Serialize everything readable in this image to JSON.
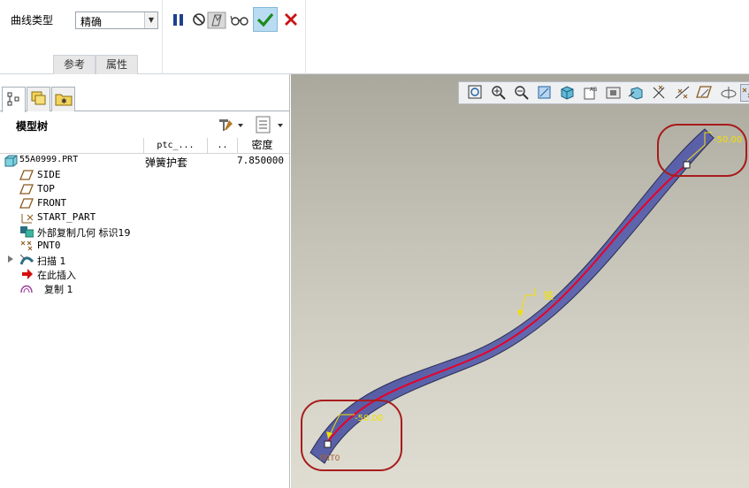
{
  "dashboard": {
    "curve_type_label": "曲线类型",
    "curve_type_value": "精确",
    "tabs": [
      {
        "label": "参考"
      },
      {
        "label": "属性"
      }
    ]
  },
  "tree": {
    "title": "模型树",
    "columns": [
      "ptc_...",
      "..",
      "密度"
    ],
    "rows": [
      {
        "name": "55A0999.PRT",
        "icon": "part-icon",
        "c1": "弹簧护套",
        "c3": "7.850000"
      },
      {
        "name": "SIDE",
        "icon": "datum-plane-icon"
      },
      {
        "name": "TOP",
        "icon": "datum-plane-icon"
      },
      {
        "name": "FRONT",
        "icon": "datum-plane-icon"
      },
      {
        "name": "START_PART",
        "icon": "csys-icon"
      },
      {
        "name": "外部复制几何 标识19",
        "icon": "external-copy-geometry-icon"
      },
      {
        "name": "PNT0",
        "icon": "datum-point-icon"
      },
      {
        "name": "扫描 1",
        "icon": "sweep-icon"
      },
      {
        "name": "在此插入",
        "icon": "insert-here-arrow-icon"
      },
      {
        "name": "复制 1",
        "icon": "copy-surface-icon"
      }
    ]
  },
  "graphics": {
    "end_value_top": "-50.00",
    "end_value_bottom": "-50.00",
    "chain_label": "链",
    "point_label": "PNT0",
    "highlight_color": "#a81c1c",
    "sweep_color": "#4a4f8a",
    "trajectory_color": "#e8002a"
  }
}
